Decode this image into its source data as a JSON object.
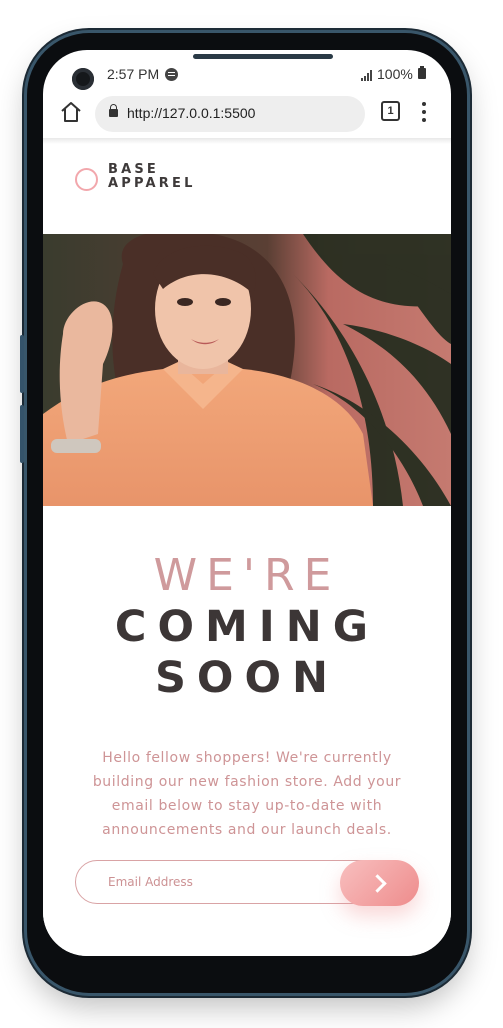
{
  "statusbar": {
    "time": "2:57 PM",
    "battery": "100%"
  },
  "browser": {
    "url": "http://127.0.0.1:5500",
    "tab_count": "1"
  },
  "brand": {
    "line1": "BASE",
    "line2": "APPAREL"
  },
  "headline": {
    "line1": "WE'RE",
    "line2": "COMING",
    "line3": "SOON"
  },
  "description": "Hello fellow shoppers! We're currently building our new fashion store. Add your email below to stay up-to-date with announcements and our launch deals.",
  "form": {
    "email_placeholder": "Email Address"
  },
  "colors": {
    "accent": "#f2a7ac",
    "button_gradient_start": "#f8bfbf",
    "button_gradient_end": "#ee8c8c",
    "heading_dark": "#3c3636",
    "heading_light": "#cf9a9c"
  }
}
